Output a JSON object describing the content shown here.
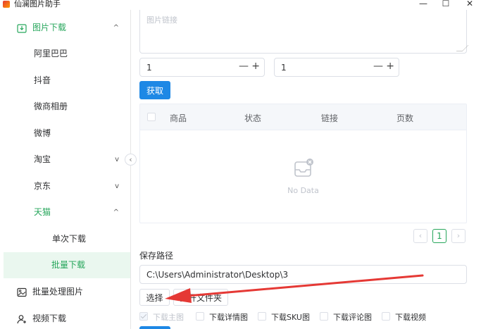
{
  "window": {
    "title": "仙澜图片助手",
    "controls": {
      "minimize": "—",
      "maximize": "☐",
      "close": "✕"
    }
  },
  "sidebar": {
    "collapse_glyph": "‹",
    "items": [
      {
        "label": "图片下载",
        "icon": "download-image-icon",
        "chevron": "^",
        "state": "expanded-active"
      },
      {
        "label": "阿里巴巴"
      },
      {
        "label": "抖音"
      },
      {
        "label": "微商相册"
      },
      {
        "label": "微博"
      },
      {
        "label": "淘宝",
        "chevron": "v"
      },
      {
        "label": "京东",
        "chevron": "v"
      },
      {
        "label": "天猫",
        "chevron": "^",
        "state": "expanded-active"
      },
      {
        "label": "单次下载"
      },
      {
        "label": "批量下载",
        "state": "selected"
      },
      {
        "label": "批量处理图片",
        "icon": "image-process-icon"
      },
      {
        "label": "视频下载",
        "icon": "user-video-icon"
      }
    ]
  },
  "main": {
    "link_placeholder": "图片链接",
    "stepper_a": {
      "value": "1",
      "minus": "—",
      "plus": "+"
    },
    "stepper_b": {
      "value": "1",
      "minus": "—",
      "plus": "+"
    },
    "fetch_label": "获取",
    "table": {
      "columns": [
        "商品",
        "状态",
        "链接",
        "页数"
      ],
      "empty_text": "No Data"
    },
    "pager": {
      "prev": "‹",
      "current": "1",
      "next": "›"
    },
    "save_path_label": "保存路径",
    "save_path_value": "C:\\Users\\Administrator\\Desktop\\3",
    "select_label": "选择",
    "open_folder_label": "打开文件夹",
    "options": [
      {
        "label": "下载主图",
        "checked": true,
        "disabled": true
      },
      {
        "label": "下载详情图",
        "checked": false
      },
      {
        "label": "下载SKU图",
        "checked": false
      },
      {
        "label": "下载评论图",
        "checked": false
      },
      {
        "label": "下载视频",
        "checked": false
      }
    ]
  },
  "colors": {
    "accent_green": "#26a65b",
    "primary_blue": "#1e88e5",
    "annotation_red": "#e53935"
  }
}
